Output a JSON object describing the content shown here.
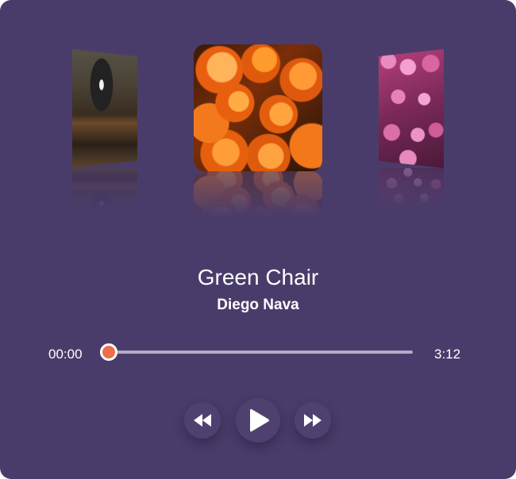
{
  "player": {
    "track_title": "Green Chair",
    "artist": "Diego Nava",
    "current_time": "00:00",
    "duration": "3:12",
    "progress": 0
  },
  "covers": [
    {
      "name": "record-player-cover",
      "position": "left"
    },
    {
      "name": "orange-roses-cover",
      "position": "center"
    },
    {
      "name": "pink-flowers-cover",
      "position": "right"
    }
  ],
  "controls": {
    "prev_icon": "rewind-icon",
    "play_icon": "play-icon",
    "next_icon": "fast-forward-icon"
  },
  "colors": {
    "background": "#4a3c6a",
    "accent": "#ea6e4b",
    "track": "#b9a8c4"
  }
}
